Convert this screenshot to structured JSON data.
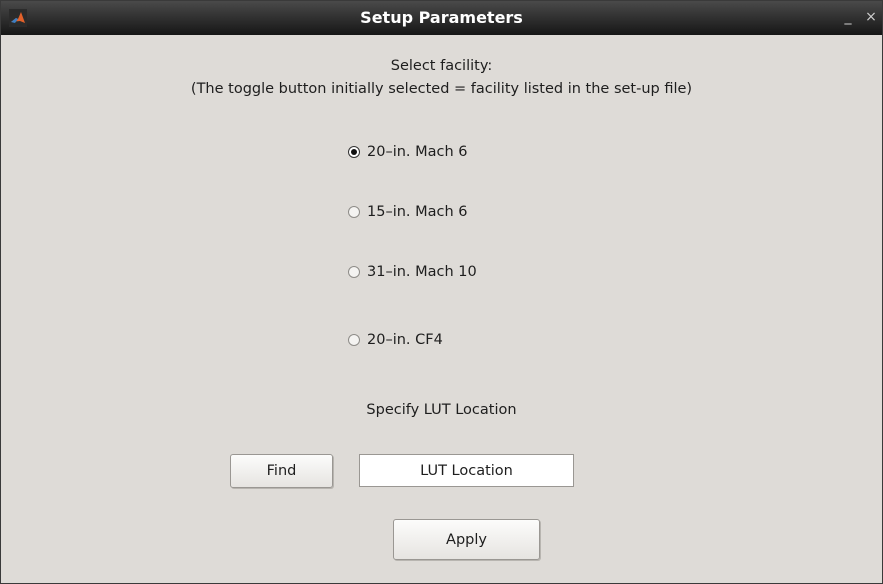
{
  "window": {
    "title": "Setup Parameters",
    "minimize_glyph": "_",
    "close_glyph": "×",
    "app_icon": "matlab-logo-icon"
  },
  "instructions": {
    "line1": "Select facility:",
    "line2": "(The toggle button initially selected = facility listed in the set-up file)"
  },
  "facilities": [
    {
      "label": "20–in. Mach 6",
      "selected": true
    },
    {
      "label": "15–in. Mach 6",
      "selected": false
    },
    {
      "label": "31–in. Mach 10",
      "selected": false
    },
    {
      "label": "20–in. CF4",
      "selected": false
    }
  ],
  "lut": {
    "heading": "Specify LUT Location",
    "find_label": "Find",
    "location_value": "LUT Location"
  },
  "apply_label": "Apply"
}
